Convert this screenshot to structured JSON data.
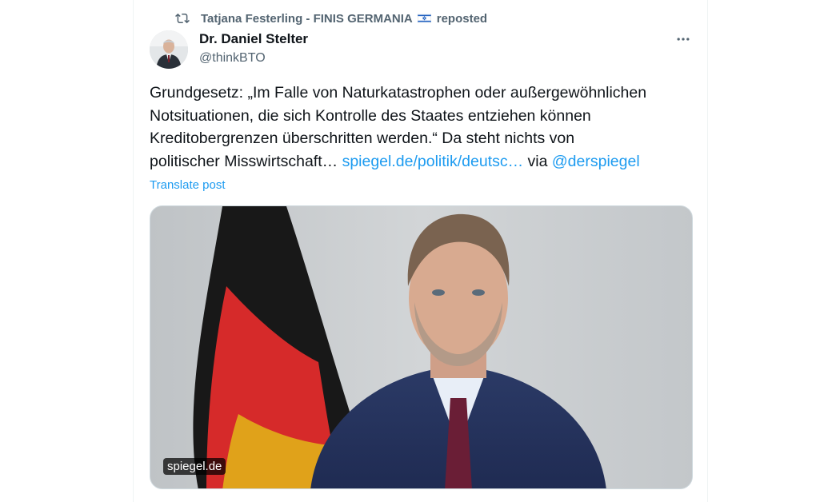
{
  "repost": {
    "reposter_name": "Tatjana Festerling - FINIS GERMANIA",
    "label": "reposted",
    "icon": "repost-icon",
    "flag_icon": "israel-flag-icon"
  },
  "author": {
    "name": "Dr. Daniel Stelter",
    "handle": "@thinkBTO",
    "more_icon": "more-options-icon"
  },
  "post": {
    "line1": "Grundgesetz: „Im Falle von Naturkatastrophen oder außergewöhnlichen",
    "line2": "Notsituationen, die sich Kontrolle des Staates entziehen können",
    "line3": "Kreditobergrenzen überschritten werden.“ Da steht nichts von",
    "line4_text": "politischer Misswirtschaft… ",
    "line4_link": "spiegel.de/politik/deutsc…",
    "line4_via": " via ",
    "line4_mention": "@derspiegel",
    "translate_label": "Translate post"
  },
  "media": {
    "source_label": "spiegel.de"
  },
  "colors": {
    "text": "#0f1419",
    "secondary": "#536471",
    "link": "#1d9bf0",
    "border": "#eff3f4"
  }
}
